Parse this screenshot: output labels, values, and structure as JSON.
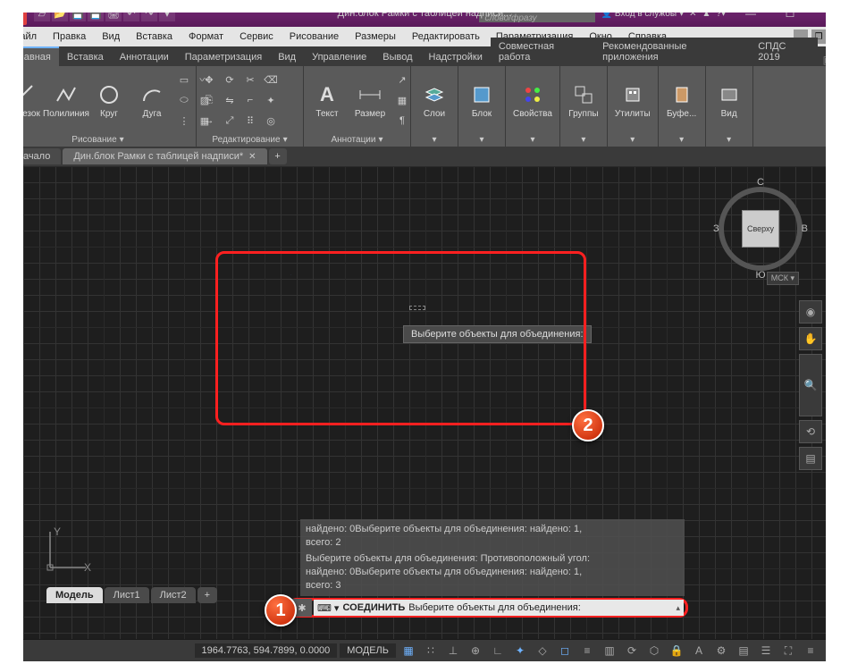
{
  "app": {
    "title": "Дин.блок Рамки с таблицей надписи...",
    "logo_letter": "A",
    "search_placeholder": "Введите ключевое слово/фразу",
    "login_text": "Вход в службы"
  },
  "menubar": {
    "items": [
      "Файл",
      "Правка",
      "Вид",
      "Вставка",
      "Формат",
      "Сервис",
      "Рисование",
      "Размеры",
      "Редактировать",
      "Параметризация",
      "Окно",
      "Справка"
    ]
  },
  "ribbon_tabs": {
    "items": [
      "Главная",
      "Вставка",
      "Аннотации",
      "Параметризация",
      "Вид",
      "Управление",
      "Вывод",
      "Надстройки",
      "Совместная работа",
      "Рекомендованные приложения",
      "СПДС 2019"
    ],
    "active_index": 0
  },
  "ribbon": {
    "panels": [
      {
        "title": "Рисование",
        "buttons": [
          "Отрезок",
          "Полилиния",
          "Круг",
          "Дуга"
        ]
      },
      {
        "title": "Редактирование"
      },
      {
        "title": "Аннотации",
        "buttons": [
          "Текст",
          "Размер"
        ]
      },
      {
        "title": "",
        "button": "Слои"
      },
      {
        "title": "",
        "button": "Блок"
      },
      {
        "title": "",
        "button": "Свойства"
      },
      {
        "title": "",
        "button": "Группы"
      },
      {
        "title": "",
        "button": "Утилиты"
      },
      {
        "title": "",
        "button": "Буфе..."
      },
      {
        "title": "",
        "button": "Вид"
      }
    ]
  },
  "doc_tabs": {
    "items": [
      "Начало",
      "Дин.блок Рамки с таблицей надписи*"
    ],
    "active_index": 1
  },
  "viewcube": {
    "face": "Сверху",
    "n": "С",
    "s": "Ю",
    "w": "З",
    "e": "В",
    "wcs": "МСК"
  },
  "tooltip": "Выберите объекты для объединения:",
  "cmd_history": {
    "line1": "найдено: 0Выберите объекты для объединения: найдено: 1,",
    "line2": "всего: 2",
    "line3": "Выберите объекты для объединения: Противоположный угол:",
    "line4": "найдено: 0Выберите объекты для объединения: найдено: 1,",
    "line5": "всего: 3"
  },
  "cmd_line": {
    "prefix": "⌨ ▾",
    "command": "СОЕДИНИТЬ",
    "prompt": "Выберите объекты для объединения:"
  },
  "model_tabs": {
    "items": [
      "Модель",
      "Лист1",
      "Лист2"
    ],
    "active_index": 0
  },
  "status": {
    "coords": "1964.7763, 594.7899, 0.0000",
    "space": "МОДЕЛЬ"
  },
  "badges": {
    "b1": "1",
    "b2": "2"
  }
}
